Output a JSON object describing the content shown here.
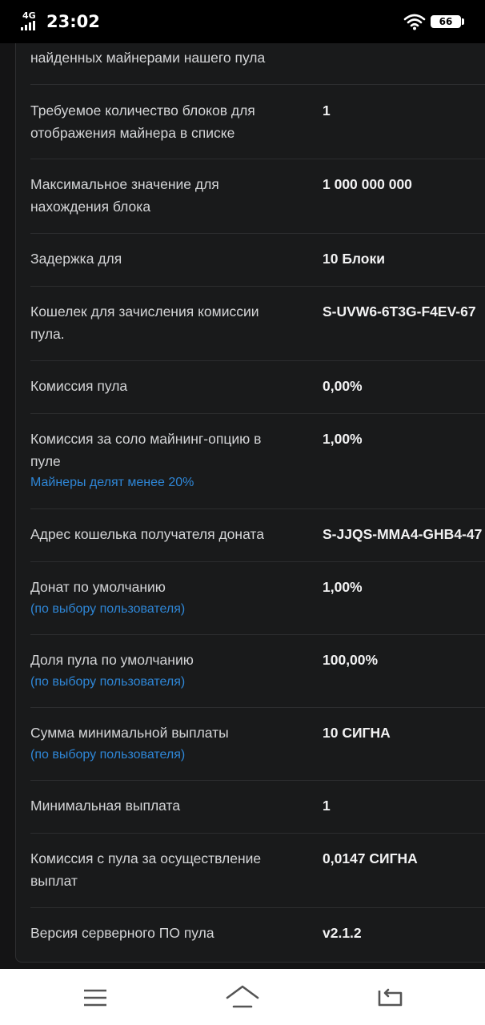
{
  "status_bar": {
    "network": "4G",
    "time": "23:02",
    "battery": "66"
  },
  "rows": [
    {
      "label": "найденных майнерами нашего пула",
      "value": "",
      "hint": ""
    },
    {
      "label": "Требуемое количество блоков для отображения майнера в списке",
      "value": "1",
      "hint": ""
    },
    {
      "label": "Максимальное значение для нахождения блока",
      "value": "1 000 000 000",
      "hint": ""
    },
    {
      "label": "Задержка для",
      "value": "10 Блоки",
      "hint": ""
    },
    {
      "label": "Кошелек для зачисления комиссии пула.",
      "value": "S-UVW6-6T3G-F4EV-67",
      "hint": ""
    },
    {
      "label": "Комиссия пула",
      "value": "0,00%",
      "hint": ""
    },
    {
      "label": "Комиссия за соло майнинг-опцию в пуле",
      "value": "1,00%",
      "hint": "Майнеры делят менее 20%"
    },
    {
      "label": "Адрес кошелька получателя доната",
      "value": "S-JJQS-MMA4-GHB4-47",
      "hint": ""
    },
    {
      "label": "Донат по умолчанию",
      "value": "1,00%",
      "hint": "(по выбору пользователя)"
    },
    {
      "label": "Доля пула по умолчанию",
      "value": "100,00%",
      "hint": "(по выбору пользователя)"
    },
    {
      "label": "Сумма минимальной выплаты",
      "value": "10 СИГНА",
      "hint": "(по выбору пользователя)"
    },
    {
      "label": "Минимальная выплата",
      "value": "1",
      "hint": ""
    },
    {
      "label": "Комиссия с пула за осуществление выплат",
      "value": "0,0147 СИГНА",
      "hint": ""
    },
    {
      "label": "Версия серверного ПО пула",
      "value": "v2.1.2",
      "hint": ""
    }
  ],
  "colors": {
    "background": "#141415",
    "card": "#191a1b",
    "label": "#d4d5d7",
    "value": "#f2f2f3",
    "hint": "#2e86d6",
    "divider": "#2c2d2f"
  },
  "icons": {
    "menu": "menu-icon",
    "home": "home-icon",
    "back": "back-icon",
    "wifi": "wifi-icon",
    "battery": "battery-icon",
    "signal": "signal-icon"
  }
}
